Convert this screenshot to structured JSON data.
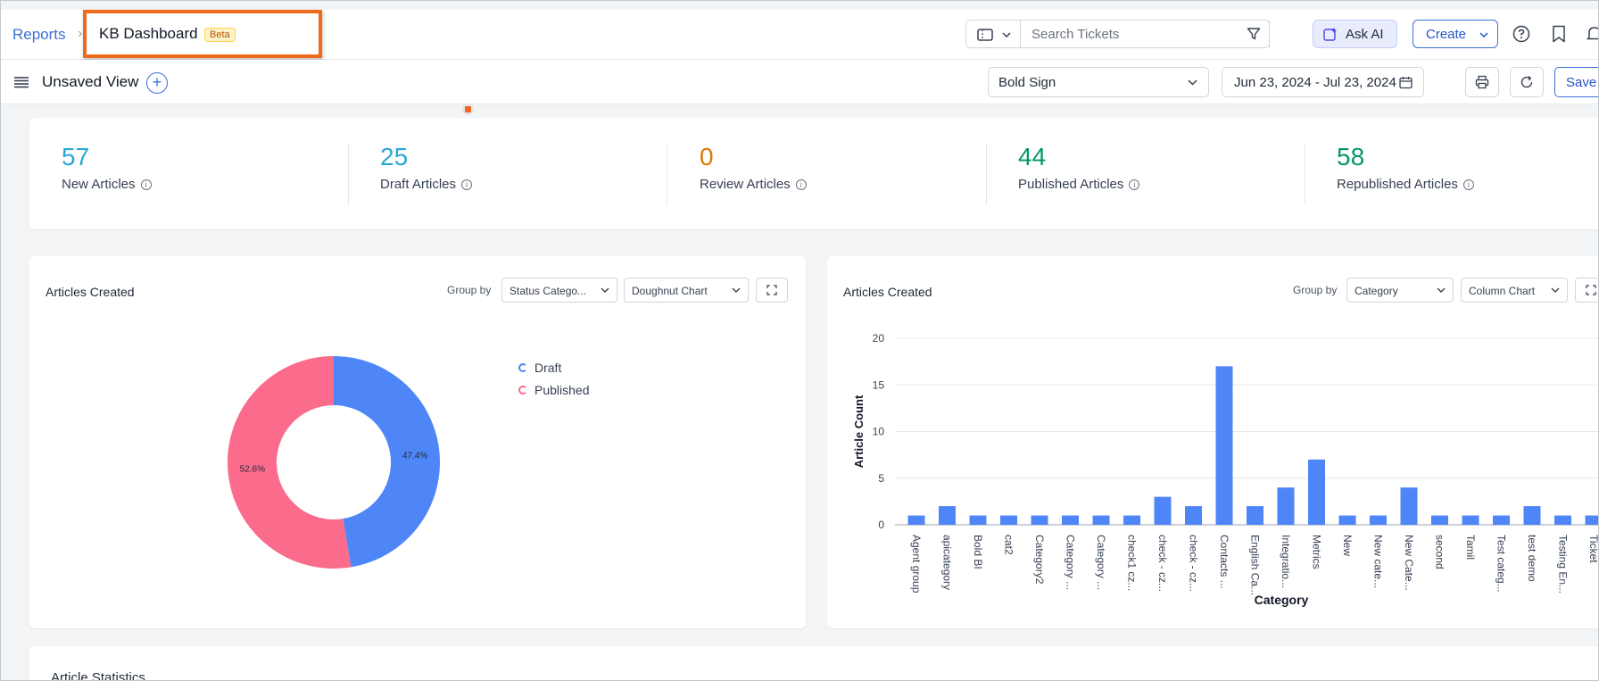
{
  "header": {
    "breadcrumb_root": "Reports",
    "title": "KB Dashboard",
    "badge": "Beta",
    "search_placeholder": "Search Tickets",
    "ask_ai_label": "Ask AI",
    "create_label": "Create"
  },
  "viewbar": {
    "view_title": "Unsaved View",
    "brand_select": "Bold Sign",
    "date_range": "Jun 23, 2024 - Jul 23, 2024",
    "save_label": "Save"
  },
  "stats": [
    {
      "value": "57",
      "label": "New Articles",
      "color": "#2aa7d6"
    },
    {
      "value": "25",
      "label": "Draft Articles",
      "color": "#2aa7d6"
    },
    {
      "value": "0",
      "label": "Review Articles",
      "color": "#d97706"
    },
    {
      "value": "44",
      "label": "Published Articles",
      "color": "#059669"
    },
    {
      "value": "58",
      "label": "Republished Articles",
      "color": "#059669"
    }
  ],
  "left_chart": {
    "title": "Articles Created",
    "group_by_label": "Group by",
    "group_by_value": "Status Catego...",
    "chart_type_value": "Doughnut Chart",
    "legend": [
      {
        "name": "Draft",
        "color": "#4f86f7"
      },
      {
        "name": "Published",
        "color": "#fb6b8c"
      }
    ]
  },
  "right_chart": {
    "title": "Articles Created",
    "group_by_label": "Group by",
    "group_by_value": "Category",
    "chart_type_value": "Column Chart"
  },
  "bottom": {
    "title": "Article Statistics"
  },
  "chart_data": [
    {
      "type": "pie",
      "title": "",
      "labels": [
        "Draft",
        "Published"
      ],
      "values": [
        47.4,
        52.6
      ],
      "data_labels": [
        "47.4%",
        "52.6%"
      ],
      "colors": [
        "#4f86f7",
        "#fb6b8c"
      ],
      "hole": true,
      "legend": "right"
    },
    {
      "type": "bar",
      "title": "",
      "xlabel": "Category",
      "ylabel": "Article Count",
      "ylim": [
        0,
        20
      ],
      "yticks": [
        "0",
        "5",
        "10",
        "15",
        "20"
      ],
      "categories": [
        "Agent group",
        "apicategory",
        "Bold BI",
        "cat2",
        "Category2",
        "Category ...",
        "Category ...",
        "check1 cz...",
        "check - cz...",
        "check - cz...",
        "Contacts ...",
        "English Ca...",
        "Integratio...",
        "Metrics",
        "New",
        "New cate...",
        "New Cate...",
        "second",
        "Tamil",
        "Test categ...",
        "test demo",
        "Testing En...",
        "Ticket"
      ],
      "values": [
        1,
        2,
        1,
        1,
        1,
        1,
        1,
        1,
        3,
        2,
        17,
        2,
        4,
        7,
        1,
        1,
        4,
        1,
        1,
        1,
        2,
        1,
        1
      ],
      "color": "#4f86f7",
      "grid": true
    }
  ]
}
